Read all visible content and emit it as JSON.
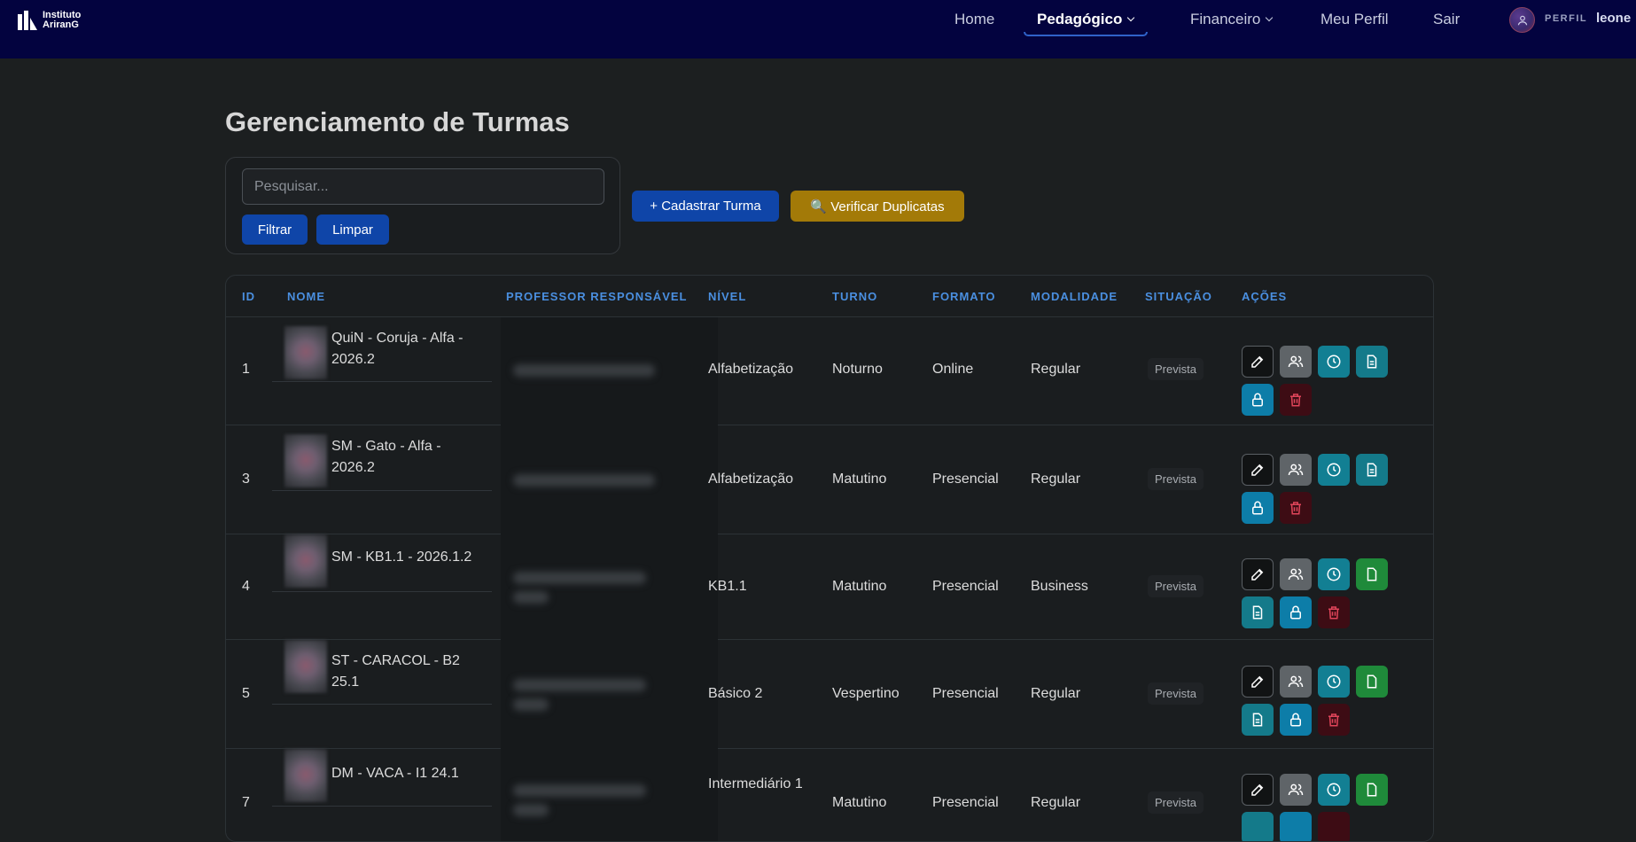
{
  "brand": {
    "line1": "Instituto",
    "line2": "AriranG"
  },
  "nav": {
    "home": "Home",
    "pedagogico": "Pedagógico",
    "financeiro": "Financeiro",
    "meu_perfil": "Meu Perfil",
    "sair": "Sair",
    "profile_label": "PERFIL",
    "username": "leone"
  },
  "page": {
    "title": "Gerenciamento de Turmas"
  },
  "search": {
    "placeholder": "Pesquisar...",
    "filter": "Filtrar",
    "clear": "Limpar"
  },
  "toolbar": {
    "add": "+ Cadastrar Turma",
    "duplicates": "🔍 Verificar Duplicatas"
  },
  "table": {
    "headers": [
      "ID",
      "NOME",
      "PROFESSOR RESPONSÁVEL",
      "NÍVEL",
      "TURNO",
      "FORMATO",
      "MODALIDADE",
      "SITUAÇÃO",
      "AÇÕES"
    ],
    "rows": [
      {
        "id": "1",
        "name": "QuiN - Coruja - Alfa - 2026.2",
        "nivel": "Alfabetização",
        "turno": "Noturno",
        "formato": "Online",
        "modalidade": "Regular",
        "situacao": "Prevista"
      },
      {
        "id": "3",
        "name": "SM - Gato - Alfa - 2026.2",
        "nivel": "Alfabetização",
        "turno": "Matutino",
        "formato": "Presencial",
        "modalidade": "Regular",
        "situacao": "Prevista"
      },
      {
        "id": "4",
        "name": "SM - KB1.1 - 2026.1.2",
        "nivel": "KB1.1",
        "turno": "Matutino",
        "formato": "Presencial",
        "modalidade": "Business",
        "situacao": "Prevista"
      },
      {
        "id": "5",
        "name": "ST - CARACOL - B2 25.1",
        "nivel": "Básico 2",
        "turno": "Vespertino",
        "formato": "Presencial",
        "modalidade": "Regular",
        "situacao": "Prevista"
      },
      {
        "id": "7",
        "name": "DM - VACA - I1 24.1",
        "nivel": "Intermediário 1",
        "turno": "Matutino",
        "formato": "Presencial",
        "modalidade": "Regular",
        "situacao": "Prevista"
      }
    ]
  },
  "colors": {
    "navbar": "#03033f",
    "primary": "#0f45a8",
    "warning": "#a37a08",
    "header_text": "#4a8fe0"
  },
  "icons": [
    "edit-icon",
    "users-icon",
    "clock-icon",
    "document-icon",
    "lock-icon",
    "trash-icon"
  ]
}
